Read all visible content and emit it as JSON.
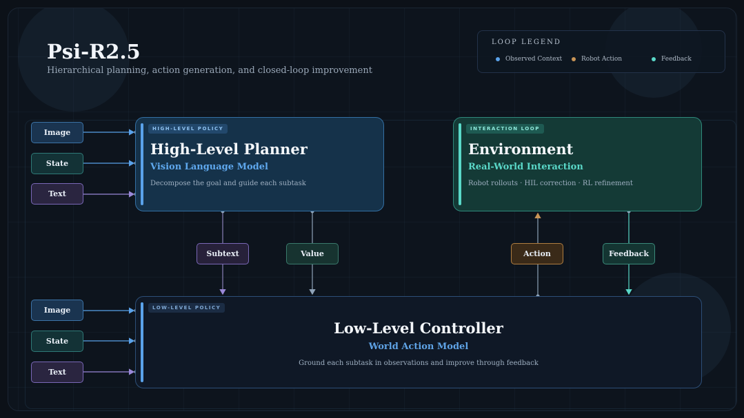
{
  "header": {
    "title": "Psi-R2.5",
    "subtitle": "Hierarchical planning, action generation, and closed-loop improvement"
  },
  "legend": {
    "title": "LOOP LEGEND",
    "items": [
      {
        "label": "Observed Context",
        "color": "#5aa2ea"
      },
      {
        "label": "Robot Action",
        "color": "#c89456"
      },
      {
        "label": "Feedback",
        "color": "#5ad8c8"
      }
    ]
  },
  "inputs_top": [
    {
      "label": "Image"
    },
    {
      "label": "State"
    },
    {
      "label": "Text"
    }
  ],
  "inputs_bottom": [
    {
      "label": "Image"
    },
    {
      "label": "State"
    },
    {
      "label": "Text"
    }
  ],
  "high_level": {
    "tag": "HIGH-LEVEL POLICY",
    "title": "High-Level Planner",
    "subtitle": "Vision Language Model",
    "description": "Decompose the goal and guide each subtask"
  },
  "environment": {
    "tag": "INTERACTION LOOP",
    "title": "Environment",
    "subtitle": "Real-World Interaction",
    "description": "Robot rollouts · HIL correction · RL refinement"
  },
  "low_level": {
    "tag": "LOW-LEVEL POLICY",
    "title": "Low-Level Controller",
    "subtitle": "World Action Model",
    "description": "Ground each subtask in observations and improve through feedback"
  },
  "connectors": {
    "subtext": "Subtext",
    "value": "Value",
    "action": "Action",
    "feedback": "Feedback"
  },
  "colors": {
    "blue": "#5aa2ea",
    "teal": "#5ad8c8",
    "purple": "#9a88d8",
    "orange": "#c89456"
  }
}
